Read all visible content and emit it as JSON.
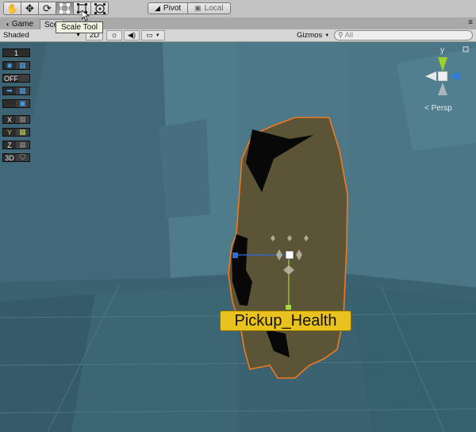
{
  "toolbar": {
    "tools": [
      {
        "name": "hand-tool",
        "icon": "hand-icon"
      },
      {
        "name": "move-tool",
        "icon": "move-arrows-icon"
      },
      {
        "name": "rotate-tool",
        "icon": "rotate-icon"
      },
      {
        "name": "scale-tool",
        "icon": "scale-icon",
        "active": true
      },
      {
        "name": "rect-tool",
        "icon": "rect-icon"
      },
      {
        "name": "transform-tool",
        "icon": "transform-icon"
      }
    ],
    "pivot_label": "Pivot",
    "local_label": "Local",
    "tooltip": "Scale Tool"
  },
  "tabs": {
    "game_label": "Game",
    "scene_label": "Sce"
  },
  "scene_toolbar": {
    "shading_mode": "Shaded",
    "mode_2d": "2D",
    "gizmos_label": "Gizmos",
    "search_placeholder": "All"
  },
  "left_panel": {
    "value_1": "1",
    "off_label": "OFF",
    "x_label": "X",
    "y_label": "Y",
    "z_label": "Z",
    "three_d_label": "3D"
  },
  "orientation_gizmo": {
    "y_label": "y",
    "projection_label": "Persp",
    "colors": {
      "y": "#9bd12a",
      "x": "#e8e8e8",
      "z": "#2f7fd6"
    }
  },
  "selection": {
    "object_name": "Pickup_Health"
  },
  "colors": {
    "sky": "#4a7584",
    "selection_outline": "#f07a1e",
    "object_fill": "#5b5437",
    "label_bg": "#e9c21d"
  }
}
